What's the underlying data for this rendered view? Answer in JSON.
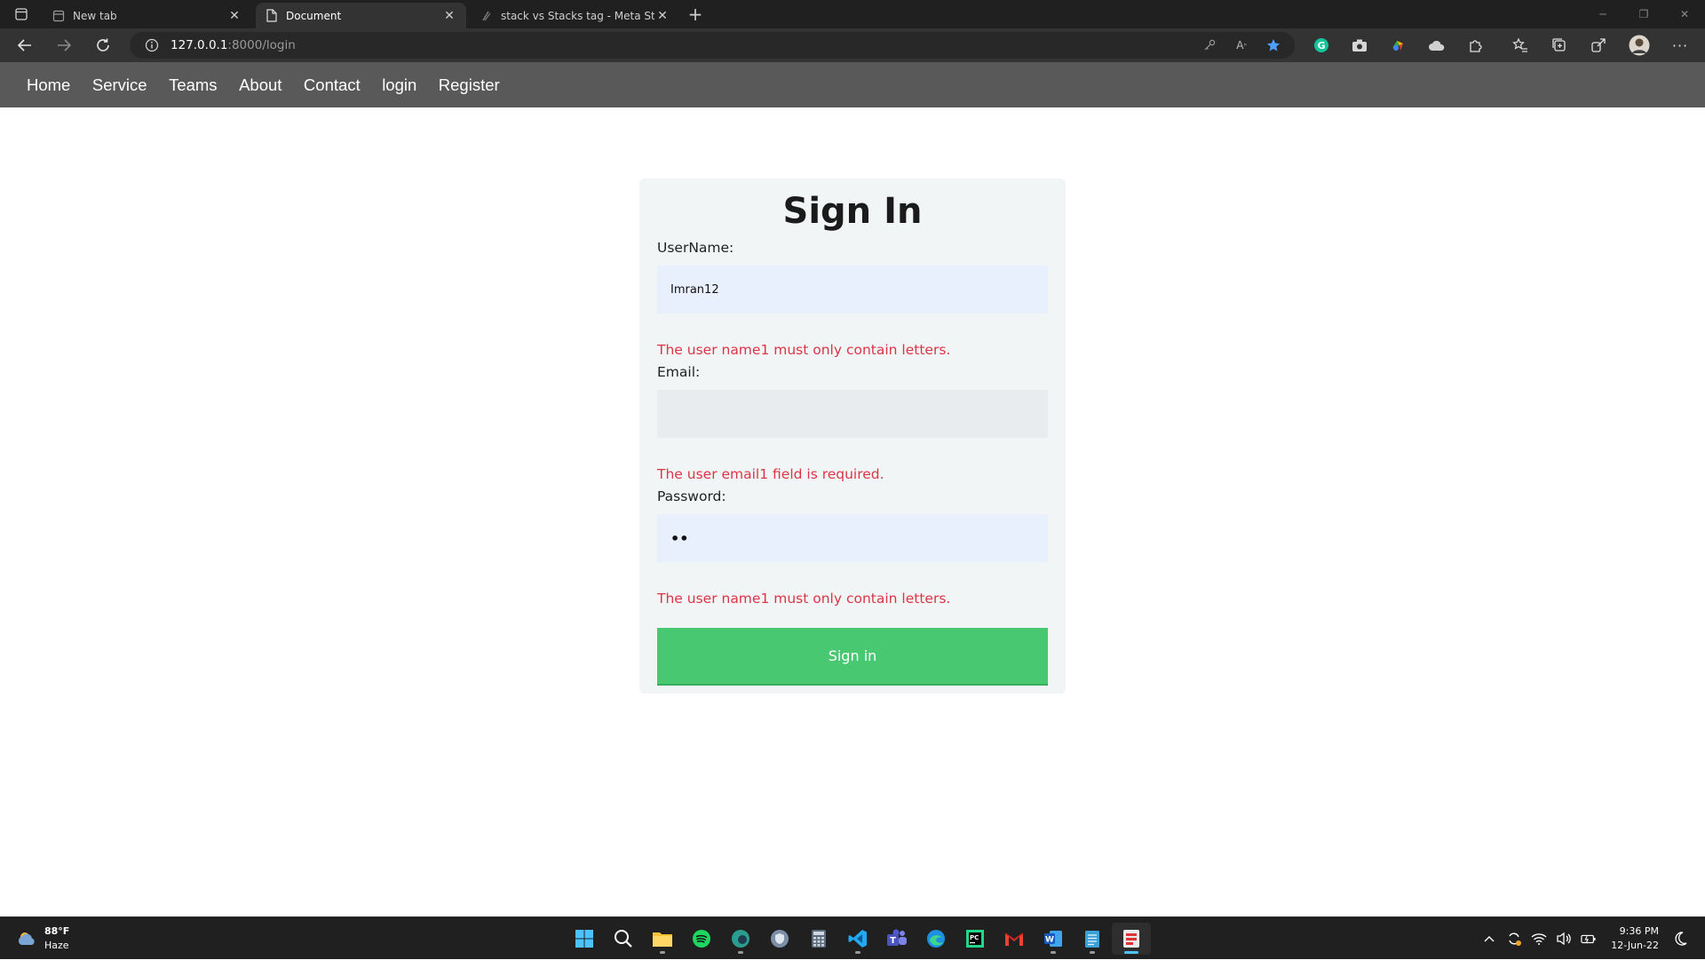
{
  "browser": {
    "tabs": [
      {
        "title": "New tab",
        "icon": "page-icon",
        "active": false
      },
      {
        "title": "Document",
        "icon": "document-icon",
        "active": true
      },
      {
        "title": "stack vs Stacks tag - Meta Stack",
        "icon": "stackexchange-icon",
        "active": false
      }
    ],
    "url_host": "127.0.0.1",
    "url_rest": ":8000/login",
    "favorite_star_color": "#4ca0ff"
  },
  "site_nav": {
    "links": [
      "Home",
      "Service",
      "Teams",
      "About",
      "Contact",
      "login",
      "Register"
    ]
  },
  "form": {
    "title": "Sign In",
    "username_label": "UserName:",
    "username_value": "Imran12",
    "username_error": "The user name1 must only contain letters.",
    "email_label": "Email:",
    "email_value": "",
    "email_error": "The user email1 field is required.",
    "password_label": "Password:",
    "password_value": "••",
    "password_error": "The user name1 must only contain letters.",
    "submit_label": "Sign in",
    "error_color": "#dc3545",
    "button_color": "#48c870"
  },
  "taskbar": {
    "weather_temp": "88°F",
    "weather_desc": "Haze",
    "time": "9:36 PM",
    "date": "12-Jun-22",
    "apps": [
      "start-icon",
      "search-icon",
      "file-explorer-icon",
      "spotify-icon",
      "edge-dev-icon",
      "security-icon",
      "calculator-icon",
      "vscode-icon",
      "teams-icon",
      "edge-icon",
      "pycharm-icon",
      "gmail-icon",
      "word-icon",
      "notepad-icon",
      "sublime-icon"
    ]
  }
}
